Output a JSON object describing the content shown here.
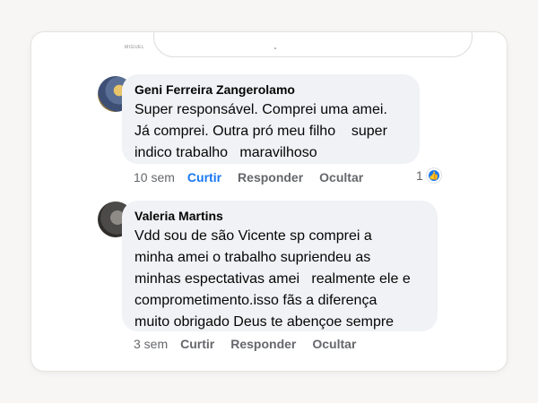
{
  "top_input": {
    "mini_text": "MIGUEL"
  },
  "comments": [
    {
      "author": "Geni Ferreira Zangerolamo",
      "text": "Super responsável. Comprei uma amei.\nJá comprei. Outra pró meu filho    super\nindico trabalho   maravilhoso",
      "time": "10 sem",
      "like_label": "Curtir",
      "reply_label": "Responder",
      "hide_label": "Ocultar",
      "reaction_count": "1",
      "reaction_icon": "like-icon"
    },
    {
      "author": "Valeria Martins",
      "text": "Vdd sou de são Vicente sp comprei a\nminha amei o trabalho supriendeu as\nminhas espectativas amei   realmente ele e\ncomprometimento.isso fãs a diferença\nmuito obrigado Deus te abençoe sempre",
      "time": "3 sem",
      "like_label": "Curtir",
      "reply_label": "Responder",
      "hide_label": "Ocultar"
    }
  ],
  "colors": {
    "accent": "#1877f2",
    "bubble": "#f0f2f5",
    "meta": "#65676b"
  }
}
